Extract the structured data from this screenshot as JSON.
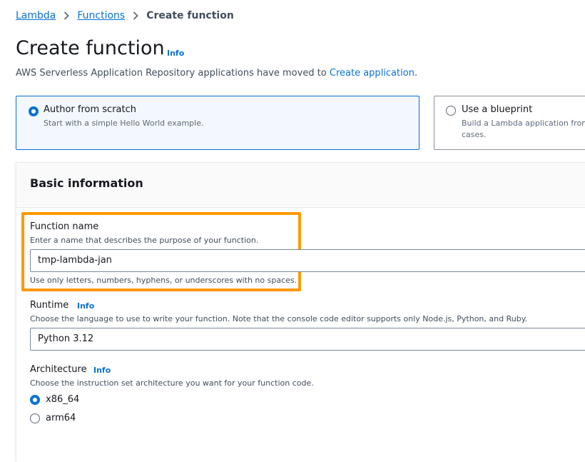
{
  "breadcrumb": {
    "items": [
      "Lambda",
      "Functions"
    ],
    "current": "Create function"
  },
  "header": {
    "title": "Create function",
    "info_label": "Info",
    "notice_text": "AWS Serverless Application Repository applications have moved to ",
    "notice_link": "Create application",
    "notice_end": "."
  },
  "options": {
    "author_from_scratch": {
      "title": "Author from scratch",
      "description": "Start with a simple Hello World example.",
      "selected": true
    },
    "use_blueprint": {
      "title": "Use a blueprint",
      "description_line1": "Build a Lambda application from",
      "description_line2": "cases.",
      "selected": false
    }
  },
  "basic_info": {
    "title": "Basic information",
    "function_name": {
      "label": "Function name",
      "description": "Enter a name that describes the purpose of your function.",
      "value": "tmp-lambda-jan",
      "constraint": "Use only letters, numbers, hyphens, or underscores with no spaces."
    },
    "runtime": {
      "label": "Runtime",
      "info_label": "Info",
      "description": "Choose the language to use to write your function. Note that the console code editor supports only Node.js, Python, and Ruby.",
      "value": "Python 3.12"
    },
    "architecture": {
      "label": "Architecture",
      "info_label": "Info",
      "description": "Choose the instruction set architecture you want for your function code.",
      "options": [
        {
          "label": "x86_64",
          "selected": true
        },
        {
          "label": "arm64",
          "selected": false
        }
      ]
    }
  },
  "colors": {
    "link": "#0972d3",
    "highlight": "#ff9900",
    "selected_tile_bg": "#f2f8fd"
  }
}
